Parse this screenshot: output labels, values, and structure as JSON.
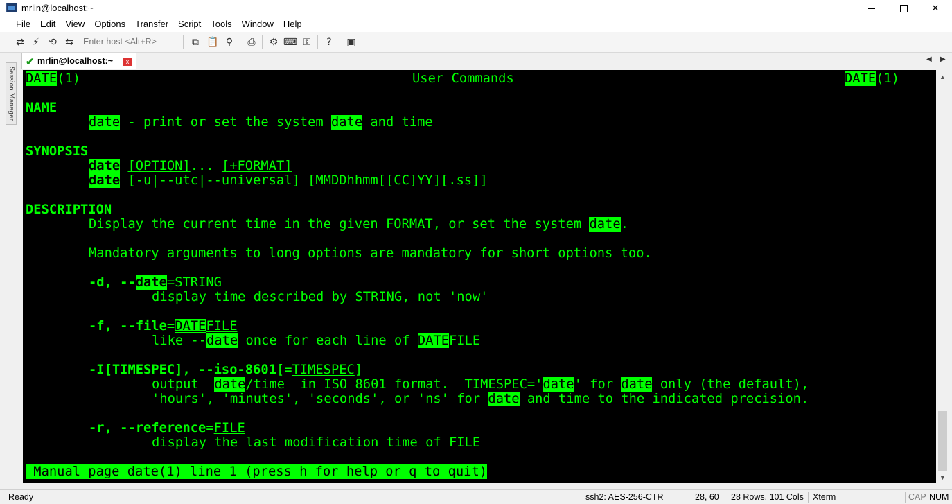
{
  "window": {
    "title": "mrlin@localhost:~"
  },
  "menu": [
    "File",
    "Edit",
    "View",
    "Options",
    "Transfer",
    "Script",
    "Tools",
    "Window",
    "Help"
  ],
  "toolbar": {
    "enter_host_placeholder": "Enter host <Alt+R>"
  },
  "session_manager": {
    "label": "Session Manager"
  },
  "tab": {
    "label": "mrlin@localhost:~",
    "close_glyph": "x"
  },
  "terminal": {
    "header_left": "DATE",
    "header_left_suffix": "(1)",
    "header_center": "User Commands",
    "header_right": "DATE",
    "header_right_suffix": "(1)",
    "name_heading": "NAME",
    "name_date1": "date",
    "name_mid": " - print or set the system ",
    "name_date2": "date",
    "name_end": " and time",
    "synopsis_heading": "SYNOPSIS",
    "syn1_date": "date",
    "syn1_option": "[OPTION]",
    "syn1_dots": "...",
    "syn1_format": "[+FORMAT]",
    "syn2_date": "date",
    "syn2_utc": "[-u|--utc|--universal]",
    "syn2_mmdd": "[MMDDhhmm[[CC]YY][.ss]]",
    "description_heading": "DESCRIPTION",
    "desc1_text": "Display the current time in the given FORMAT, or set the system ",
    "desc1_date": "date",
    "desc1_end": ".",
    "desc2": "Mandatory arguments to long options are mandatory for short options too.",
    "opt_d_prefix": "-d, --",
    "opt_d_date": "date",
    "opt_d_eq": "=",
    "opt_d_arg": "STRING",
    "opt_d_desc": "display time described by STRING, not 'now'",
    "opt_f_prefix": "-f, --file",
    "opt_f_eq": "=",
    "opt_f_arg_date": "DATE",
    "opt_f_arg_file": "FILE",
    "opt_f_desc1": "like --",
    "opt_f_desc_date": "date",
    "opt_f_desc2": " once for each line of ",
    "opt_f_desc_date2": "DATE",
    "opt_f_desc3": "FILE",
    "opt_i_prefix": "-I[TIMESPEC], --iso-8601",
    "opt_i_bracket_open": "[=",
    "opt_i_arg": "TIMESPEC",
    "opt_i_bracket_close": "]",
    "opt_i_l1_a": "output  ",
    "opt_i_l1_date": "date",
    "opt_i_l1_b": "/time  in ISO 8601 format.  TIMESPEC='",
    "opt_i_l1_date2": "date",
    "opt_i_l1_c": "' for ",
    "opt_i_l1_date3": "date",
    "opt_i_l1_d": " only (the default),",
    "opt_i_l2_a": "'hours', 'minutes', 'seconds', or 'ns' for ",
    "opt_i_l2_date": "date",
    "opt_i_l2_b": " and time to the indicated precision.",
    "opt_r_prefix": "-r, --reference",
    "opt_r_eq": "=",
    "opt_r_arg": "FILE",
    "opt_r_desc": "display the last modification time of FILE",
    "status_line": " Manual page date(1) line 1 (press h for help or q to quit)"
  },
  "statusbar": {
    "ready": "Ready",
    "cipher": "ssh2: AES-256-CTR",
    "position": "28,  60",
    "dims": "28 Rows, 101 Cols",
    "term": "Xterm",
    "cap": "CAP",
    "num": "NUM"
  },
  "colors": {
    "terminal_fg": "#00ff00",
    "terminal_bg": "#000000"
  }
}
